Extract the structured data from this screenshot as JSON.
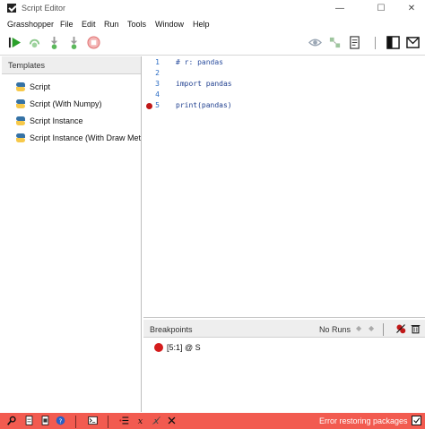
{
  "window": {
    "title": "Script Editor",
    "minimize_glyph": "—",
    "maximize_glyph": "☐",
    "close_glyph": "✕"
  },
  "menu": [
    "Grasshopper",
    "File",
    "Edit",
    "Run",
    "Tools",
    "Window",
    "Help"
  ],
  "toolbar": {
    "left_icons": [
      "run-icon",
      "run-with-debug-icon",
      "step-over-icon",
      "step-into-icon",
      "stop-icon"
    ],
    "right_icons": [
      "preview-eye-icon",
      "shapes-icon",
      "document-icon",
      "toggle-browser-icon",
      "toggle-console-icon"
    ]
  },
  "templates": {
    "header": "Templates",
    "items": [
      "Script",
      "Script (With Numpy)",
      "Script Instance",
      "Script Instance (With Draw Met"
    ]
  },
  "editor": {
    "lines": [
      {
        "num": "1",
        "code": "# r: pandas",
        "type": "comment",
        "breakpoint": false
      },
      {
        "num": "2",
        "code": "",
        "type": "code",
        "breakpoint": false
      },
      {
        "num": "3",
        "code": "import pandas",
        "type": "code",
        "breakpoint": false
      },
      {
        "num": "4",
        "code": "",
        "type": "code",
        "breakpoint": false
      },
      {
        "num": "5",
        "code": "print(pandas)",
        "type": "code",
        "breakpoint": true
      }
    ]
  },
  "breakpoints": {
    "header": "Breakpoints",
    "runs": "No Runs",
    "prev_glyph": "◆",
    "next_glyph": "◆",
    "items": [
      {
        "label": "[5:1] @ S"
      }
    ]
  },
  "status": {
    "message": "Error restoring packages",
    "left_icons": [
      "search-icon",
      "document-icon",
      "document-icon",
      "help-icon",
      "console-icon",
      "list-icon",
      "formula-icon",
      "formula-off-icon",
      "tools-icon"
    ]
  },
  "colors": {
    "status_bar": "#f25b50",
    "breakpoint": "#c01818",
    "line_number": "#2b6cc4",
    "code_text": "#1f3f8f"
  }
}
